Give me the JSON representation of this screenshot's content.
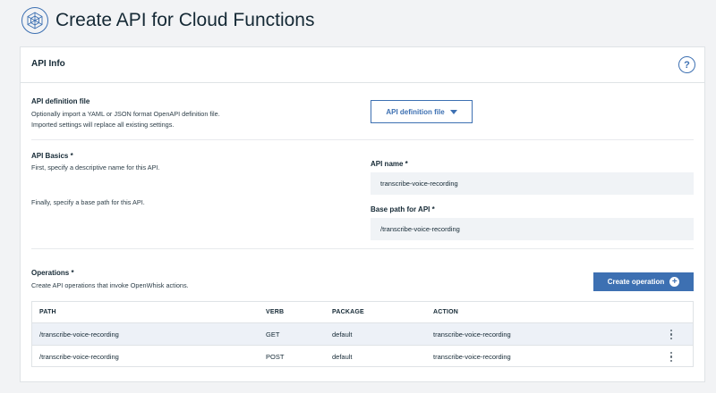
{
  "header": {
    "title": "Create API for Cloud Functions",
    "logo_icon": "api-globe-icon"
  },
  "card": {
    "title": "API Info",
    "help_symbol": "?",
    "definition_file": {
      "label": "API definition file",
      "desc_line1": "Optionally import a YAML or JSON format OpenAPI definition file.",
      "desc_line2": "Imported settings will replace all existing settings.",
      "button_label": "API definition file"
    },
    "basics": {
      "label": "API Basics *",
      "desc_name": "First, specify a descriptive name for this API.",
      "desc_path": "Finally, specify a base path for this API.",
      "api_name_label": "API name *",
      "api_name_value": "transcribe-voice-recording",
      "base_path_label": "Base path for API *",
      "base_path_value": "/transcribe-voice-recording"
    },
    "operations": {
      "label": "Operations *",
      "desc": "Create API operations that invoke OpenWhisk actions.",
      "create_button": "Create operation",
      "columns": [
        "PATH",
        "VERB",
        "PACKAGE",
        "ACTION"
      ],
      "rows": [
        {
          "path": "/transcribe-voice-recording",
          "verb": "GET",
          "package": "default",
          "action": "transcribe-voice-recording"
        },
        {
          "path": "/transcribe-voice-recording",
          "verb": "POST",
          "package": "default",
          "action": "transcribe-voice-recording"
        }
      ]
    }
  },
  "colors": {
    "accent": "#3d70b2",
    "row_highlight": "#edf1f7",
    "field_bg": "#f0f3f6"
  }
}
